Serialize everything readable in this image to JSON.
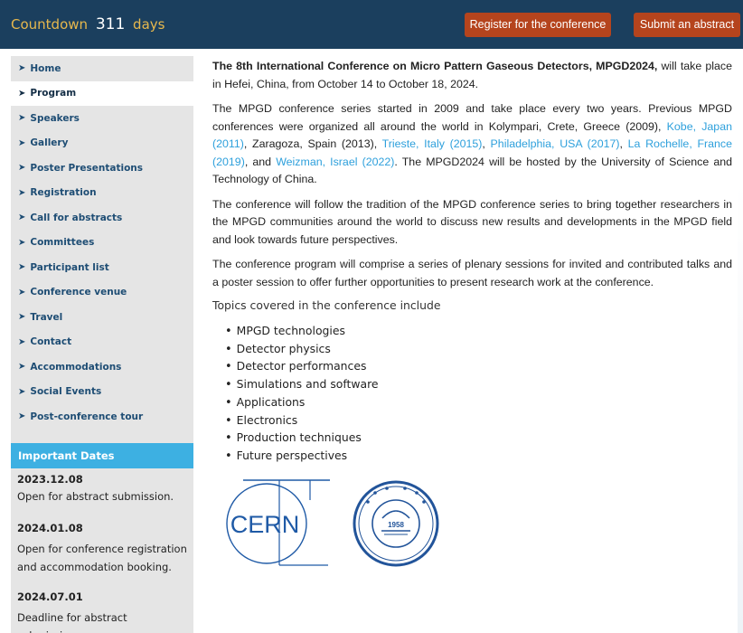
{
  "header": {
    "countdown_label": "Countdown",
    "countdown_value": "311",
    "countdown_unit": "days",
    "register_label": "Register for the conference",
    "submit_label": "Submit an abstract"
  },
  "sidebar": {
    "items": [
      {
        "label": "Home"
      },
      {
        "label": "Program"
      },
      {
        "label": "Speakers"
      },
      {
        "label": "Gallery"
      },
      {
        "label": "Poster Presentations"
      },
      {
        "label": "Registration"
      },
      {
        "label": "Call for abstracts"
      },
      {
        "label": "Committees"
      },
      {
        "label": "Participant list"
      },
      {
        "label": "Conference venue"
      },
      {
        "label": "Travel"
      },
      {
        "label": "Contact"
      },
      {
        "label": "Accommodations"
      },
      {
        "label": "Social Events"
      },
      {
        "label": "Post-conference tour"
      }
    ],
    "important_dates_title": "Important Dates",
    "dates": [
      {
        "date": "2023.12.08",
        "desc": "Open for abstract submission."
      },
      {
        "date": "2024.01.08",
        "desc": "Open for conference registration and accommodation booking."
      },
      {
        "date": "2024.07.01",
        "desc": "Deadline for abstract submission."
      }
    ]
  },
  "main": {
    "intro_bold": "The 8th International Conference on Micro Pattern Gaseous Detectors, MPGD2024,",
    "intro_rest": " will take place in Hefei, China, from October 14 to October 18, 2024.",
    "p2_a": "The MPGD conference series started in 2009 and take place every two years. Previous MPGD conferences were organized all around the world in Kolympari, Crete, Greece (2009), ",
    "link_kobe": "Kobe, Japan (2011)",
    "p2_b": ", Zaragoza, Spain (2013), ",
    "link_trieste": "Trieste, Italy (2015)",
    "p2_c": ", ",
    "link_philadelphia": "Philadelphia, USA (2017)",
    "p2_d": ", ",
    "link_larochelle": "La Rochelle, France (2019)",
    "p2_e": ", and ",
    "link_weizman": "Weizman, Israel (2022)",
    "p2_f": ". The MPGD2024 will be hosted by the University of Science and Technology of China.",
    "p3": "The conference will follow the tradition of the MPGD conference series to bring together researchers in the MPGD communities around the world to discuss new results and developments in the MPGD field and look towards future perspectives.",
    "p4": "The conference program will comprise a series of plenary sessions for invited and contributed talks and a poster session to offer further opportunities to present research work at the conference.",
    "topics_intro": "Topics covered in the conference include",
    "topics": [
      "MPGD technologies",
      "Detector physics",
      "Detector performances",
      "Simulations and software",
      "Applications",
      "Electronics",
      "Production techniques",
      "Future perspectives"
    ]
  },
  "logos": {
    "cern_text": "CERN",
    "ustc_year": "1958",
    "ustc_ring_text": "University of Science and Technology of China"
  },
  "colors": {
    "header_bg": "#1b3f5e",
    "button_bg": "#b5441d",
    "accent_blue": "#3db0e2",
    "link": "#2ea0dc",
    "cern_blue": "#1f5aa6",
    "ustc_blue": "#22549a"
  }
}
